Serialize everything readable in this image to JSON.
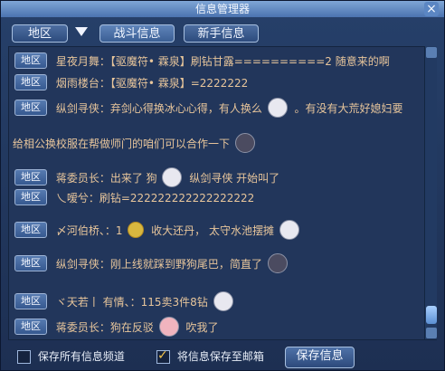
{
  "window": {
    "title": "信息管理器",
    "close": "×"
  },
  "toolbar": {
    "channel_select": "地区",
    "tab_battle": "战斗信息",
    "tab_newbie": "新手信息"
  },
  "messages": [
    {
      "badge": "地区",
      "text": "星夜月舞：【驱魔符• 霖泉】刷钻甘露==========2 随意来的啊"
    },
    {
      "badge": "地区",
      "text": "烟雨楼台：【驱魔符• 霖泉】=2222222"
    },
    {
      "badge": "地区",
      "text": "纵剑寻侠：弃剑心得换冰心心得，有人换么",
      "tail": "。有没有大荒好媳妇要"
    },
    {
      "badge": "",
      "text": "给相公换校服在帮做师门的咱们可以合作一下"
    },
    {
      "badge": "地区",
      "text": "蒋委员长：出来了 狗",
      "mid": "纵剑寻侠 开始叫了"
    },
    {
      "badge": "地区",
      "text": "乀嗳兮：刷钻=222222222222222222"
    },
    {
      "badge": "地区",
      "text": "〆河伯桥、：1",
      "mid": "收大还丹， 太守水池摆摊"
    },
    {
      "badge": "地区",
      "text": "纵剑寻侠：刚上线就踩到野狗尾巴，简直了"
    },
    {
      "badge": "地区",
      "text": "ヾ天若丨 有情、：115卖3件8钻"
    },
    {
      "badge": "地区",
      "text": "蒋委员长：狗在反驳",
      "mid": "吹我了"
    }
  ],
  "bottom": {
    "check_save_all": "保存所有信息频道",
    "check_save_mail": "将信息保存至邮箱",
    "save_button": "保存信息"
  }
}
